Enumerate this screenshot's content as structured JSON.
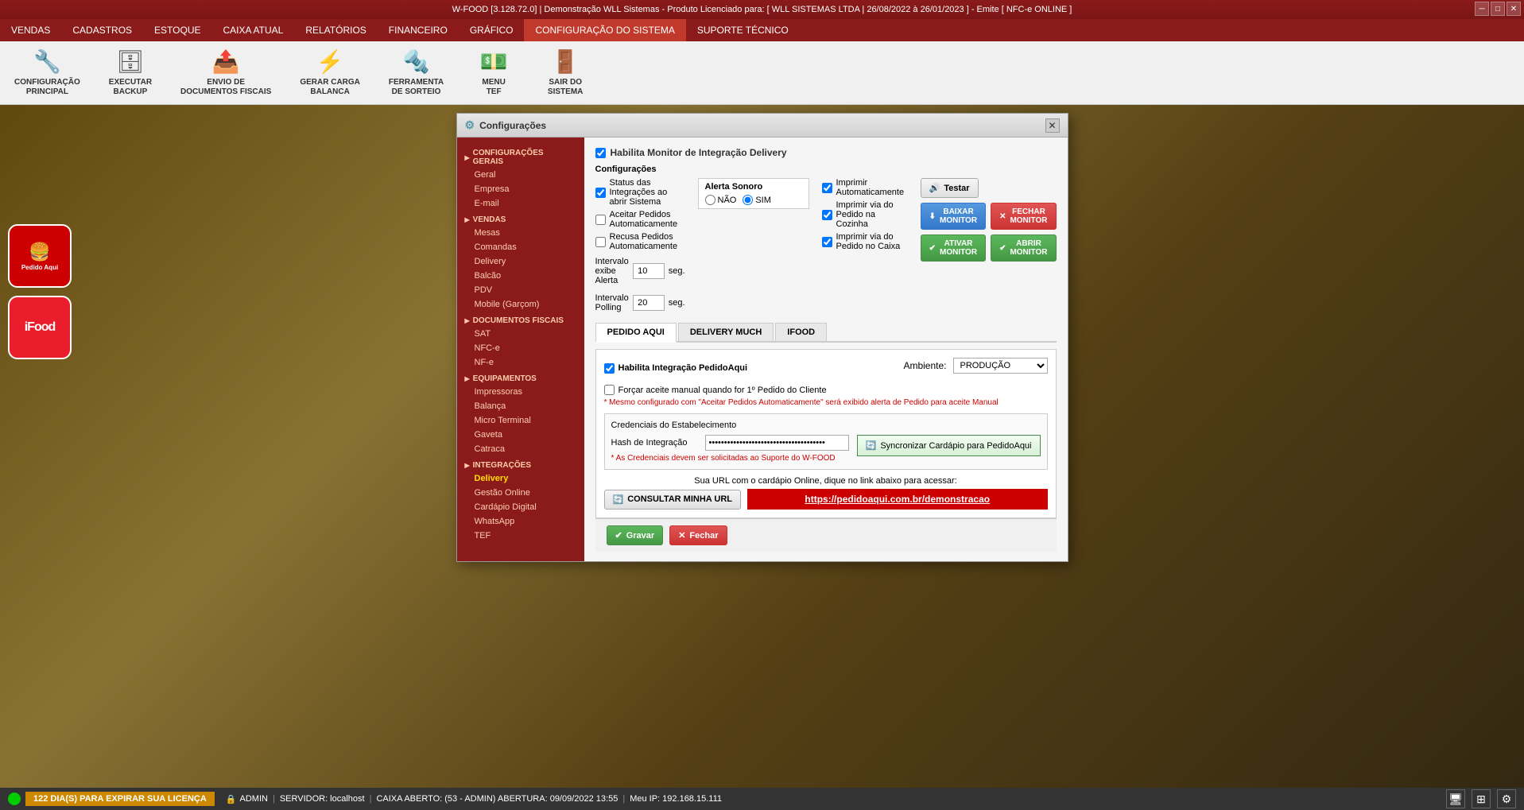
{
  "titlebar": {
    "text": "W-FOOD [3.128.72.0]  |  Demonstração WLL Sistemas - Produto Licenciado para:  [ WLL SISTEMAS LTDA | 26/08/2022 à 26/01/2023 ]  - Emite [ NFC-e ONLINE ]"
  },
  "menubar": {
    "items": [
      {
        "label": "VENDAS",
        "active": false
      },
      {
        "label": "CADASTROS",
        "active": false
      },
      {
        "label": "ESTOQUE",
        "active": false
      },
      {
        "label": "CAIXA ATUAL",
        "active": false
      },
      {
        "label": "RELATÓRIOS",
        "active": false
      },
      {
        "label": "FINANCEIRO",
        "active": false
      },
      {
        "label": "GRÁFICO",
        "active": false
      },
      {
        "label": "CONFIGURAÇÃO DO SISTEMA",
        "active": true
      },
      {
        "label": "SUPORTE TÉCNICO",
        "active": false
      }
    ]
  },
  "toolbar": {
    "items": [
      {
        "label": "CONFIGURAÇÃO\nPRINCIPAL",
        "icon": "wrench"
      },
      {
        "label": "EXECUTAR\nBACKUP",
        "icon": "database"
      },
      {
        "label": "ENVIO DE\nDOCUMENTOS FISCAIS",
        "icon": "send"
      },
      {
        "label": "GERAR CARGA\nBALANCA",
        "icon": "bolt"
      },
      {
        "label": "FERRAMENTA\nDE SORTEIO",
        "icon": "tool"
      },
      {
        "label": "MENU\nTEF",
        "icon": "cash"
      },
      {
        "label": "SAIR DO\nSISTEMA",
        "icon": "exit"
      }
    ]
  },
  "dialog": {
    "title": "Configurações",
    "sidebar": {
      "sections": [
        {
          "header": "CONFIGURAÇÕES GERAIS",
          "items": [
            "Geral",
            "Empresa",
            "E-mail"
          ]
        },
        {
          "header": "VENDAS",
          "items": [
            "Mesas",
            "Comandas",
            "Delivery",
            "Balcão",
            "PDV",
            "Mobile (Garçom)"
          ]
        },
        {
          "header": "DOCUMENTOS FISCAIS",
          "items": [
            "SAT",
            "NFC-e",
            "NF-e"
          ]
        },
        {
          "header": "EQUIPAMENTOS",
          "items": [
            "Impressoras",
            "Balança",
            "Micro Terminal",
            "Gaveta",
            "Catraca"
          ]
        },
        {
          "header": "INTEGRAÇÕES",
          "items": [
            "Delivery",
            "Gestão Online",
            "Cardápio Digital",
            "WhatsApp",
            "TEF"
          ]
        }
      ]
    },
    "content": {
      "main_checkbox": "Habilita Monitor de Integração Delivery",
      "configuracoes_label": "Configurações",
      "status_integracoes_label": "Status das Integrações ao abrir Sistema",
      "aceitar_pedidos_label": "Aceitar Pedidos Automaticamente",
      "recusar_pedidos_label": "Recusa Pedidos Automaticamente",
      "alerta_sonoro_label": "Alerta Sonoro",
      "nao_label": "NÃO",
      "sim_label": "SIM",
      "imprimir_automaticamente_label": "Imprimir Automaticamente",
      "imprimir_cozinha_label": "Imprimir via do Pedido na Cozinha",
      "imprimir_caixa_label": "Imprimir via do Pedido no Caixa",
      "intervalo_exibe_label": "Intervalo exibe Alerta",
      "intervalo_polling_label": "Intervalo Polling",
      "seg_label": "seg.",
      "seg2_label": "seg.",
      "intervalo_exibe_value": "10",
      "intervalo_polling_value": "20",
      "btn_testar": "Testar",
      "btn_baixar": "BAIXAR\nMONITOR",
      "btn_fechar": "FECHAR\nMONITOR",
      "btn_ativar": "ATIVAR\nMONITOR",
      "btn_abrir": "ABRIR MONITOR",
      "tabs": [
        "PEDIDO AQUI",
        "DELIVERY MUCH",
        "IFOOD"
      ],
      "active_tab": "PEDIDO AQUI",
      "habilita_pedidoaqui_label": "Habilita Integração PedidoAqui",
      "forcar_aceite_label": "Forçar aceite manual quando for 1º Pedido do Cliente",
      "mesmo_config_note": "* Mesmo configurado com \"Aceitar Pedidos Automaticamente\" será exibido alerta de Pedido para aceite Manual",
      "ambiente_label": "Ambiente:",
      "ambiente_value": "PRODUÇÃO",
      "credenciais_label": "Credenciais do Estabelecimento",
      "hash_label": "Hash de Integração",
      "hash_value": "••••••••••••••••••••••••••••••••••••••",
      "warning_credenciais": "* As Credenciais devem ser solicitadas ao Suporte do W-FOOD",
      "btn_sincronizar": "Syncronizar Cardápio para PedidoAqui",
      "url_label": "Sua URL com o cardápio Online, dique no link abaixo para acessar:",
      "btn_consultar": "CONSULTAR MINHA URL",
      "url_link": "https://pedidoaqui.com.br/demonstracao"
    },
    "footer": {
      "btn_gravar": "Gravar",
      "btn_fechar": "Fechar"
    }
  },
  "statusbar": {
    "license": "122 DIA(S) PARA EXPIRAR SUA LICENÇA",
    "user": "ADMIN",
    "server": "SERVIDOR: localhost",
    "caixa": "CAIXA ABERTO: (53 - ADMIN) ABERTURA: 09/09/2022 13:55",
    "ip": "Meu IP: 192.168.15.111"
  }
}
